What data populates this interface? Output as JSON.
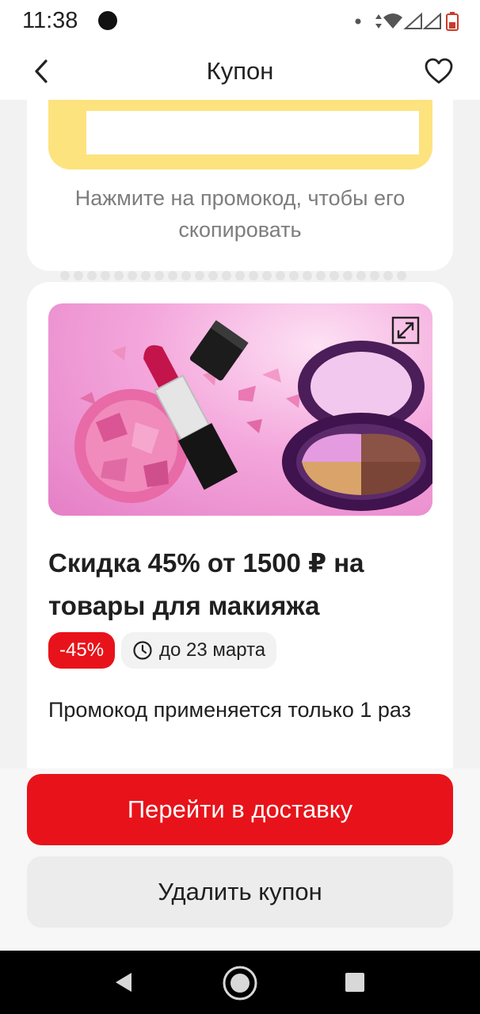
{
  "status_bar": {
    "time": "11:38"
  },
  "header": {
    "title": "Купон",
    "back_icon": "chevron-left-icon",
    "favorite_icon": "heart-icon"
  },
  "promo": {
    "code": "",
    "hint": "Нажмите на промокод, чтобы его скопировать"
  },
  "offer": {
    "title": "Скидка 45% от 1500 ₽ на товары для макияжа",
    "discount_badge": "-45%",
    "date_badge": "до 23 марта",
    "note": "Промокод применяется только 1 раз"
  },
  "actions": {
    "primary_label": "Перейти в доставку",
    "secondary_label": "Удалить купон"
  },
  "colors": {
    "accent": "#e8131a",
    "promo_bg": "#fde37e"
  }
}
